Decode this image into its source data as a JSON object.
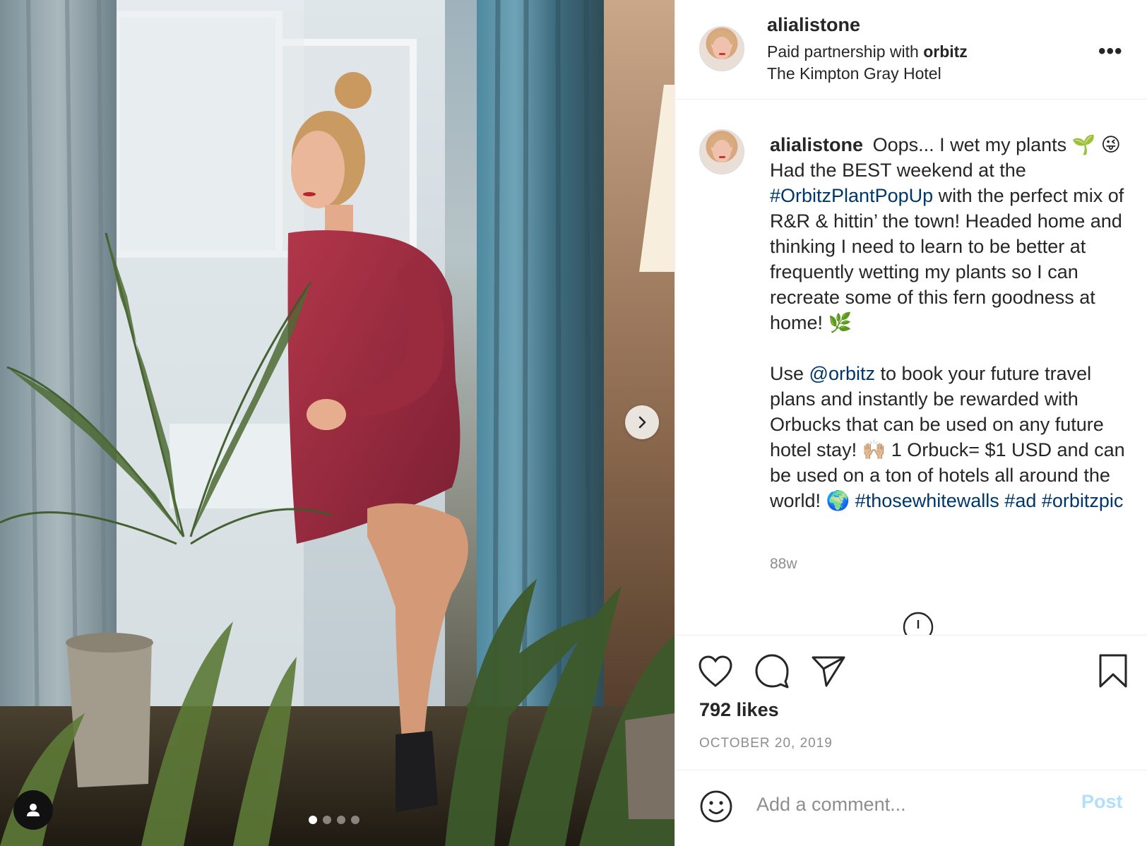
{
  "post": {
    "author": "alialistone",
    "partnership_prefix": "Paid partnership with",
    "partner": "orbitz",
    "location": "The Kimpton Gray Hotel",
    "more_label": "•••"
  },
  "caption": {
    "author": "alialistone",
    "text_1": "Oops... I wet my plants 🌱 😜 Had the BEST weekend at the",
    "hashtag_1": "#OrbitzPlantPopUp",
    "text_2": "with the perfect mix of R&R & hittin’ the town! Headed home and thinking I need to learn to be better at frequently wetting my plants so I can recreate some of this fern goodness at home! 🌿",
    "text_3": "Use",
    "mention": "@orbitz",
    "text_4": "to book your future travel plans and instantly be rewarded with Orbucks that can be used on any future hotel stay! 🙌🏼 1 Orbuck= $1 USD and can be used on a ton of hotels all around the world! 🌍",
    "hashtag_2": "#thosewhitewalls",
    "hashtag_3": "#ad",
    "hashtag_4": "#orbitzpic",
    "age": "88w"
  },
  "actions": {
    "likes": "792 likes",
    "date": "OCTOBER 20, 2019"
  },
  "comment": {
    "placeholder": "Add a comment...",
    "post_label": "Post"
  },
  "carousel": {
    "slides": 4,
    "active_index": 0
  },
  "colors": {
    "link": "#00376b",
    "post_disabled": "#b2dffc",
    "muted": "#8e8e8e"
  }
}
